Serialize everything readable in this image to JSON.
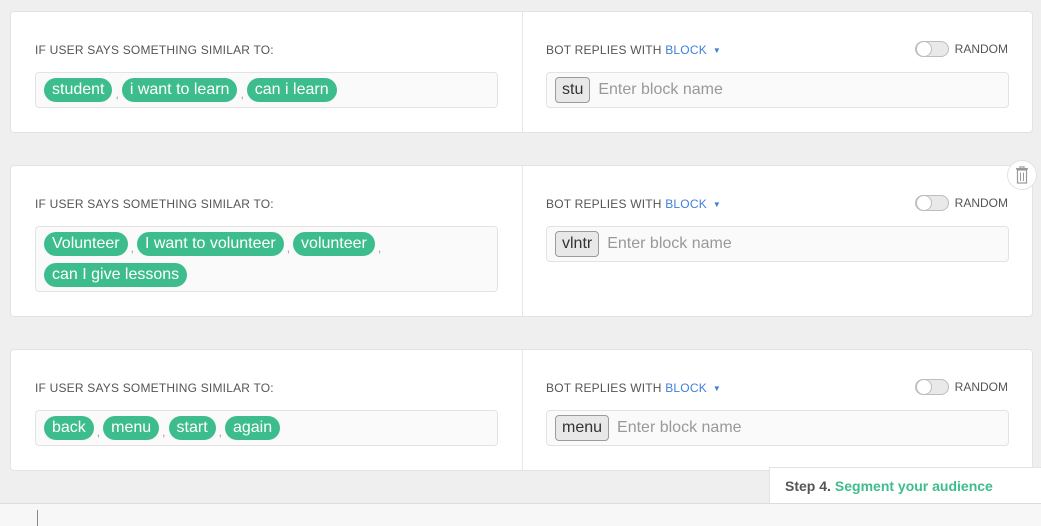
{
  "rules": [
    {
      "user_says_label": "IF USER SAYS SOMETHING SIMILAR TO:",
      "bot_replies_label": "BOT REPLIES WITH",
      "block_type": "BLOCK",
      "random_label": "RANDOM",
      "random_on": false,
      "phrases": [
        "student",
        "i want to learn",
        "can i learn"
      ],
      "block": "stu",
      "block_placeholder": "Enter block name"
    },
    {
      "user_says_label": "IF USER SAYS SOMETHING SIMILAR TO:",
      "bot_replies_label": "BOT REPLIES WITH",
      "block_type": "BLOCK",
      "random_label": "RANDOM",
      "random_on": false,
      "phrases": [
        "Volunteer",
        "I want to volunteer",
        "volunteer",
        "can I give lessons"
      ],
      "block": "vlntr",
      "block_placeholder": "Enter block name"
    },
    {
      "user_says_label": "IF USER SAYS SOMETHING SIMILAR TO:",
      "bot_replies_label": "BOT REPLIES WITH",
      "block_type": "BLOCK",
      "random_label": "RANDOM",
      "random_on": false,
      "phrases": [
        "back",
        "menu",
        "start",
        "again"
      ],
      "block": "menu",
      "block_placeholder": "Enter block name"
    }
  ],
  "step": {
    "number": "Step 4.",
    "link": "Segment your audience"
  },
  "icons": {
    "delete": "trash-icon",
    "dropdown": "caret-down-icon"
  },
  "colors": {
    "chip": "#3dbd8d",
    "link": "#3f7fd6",
    "step_link": "#3dbd8d"
  }
}
